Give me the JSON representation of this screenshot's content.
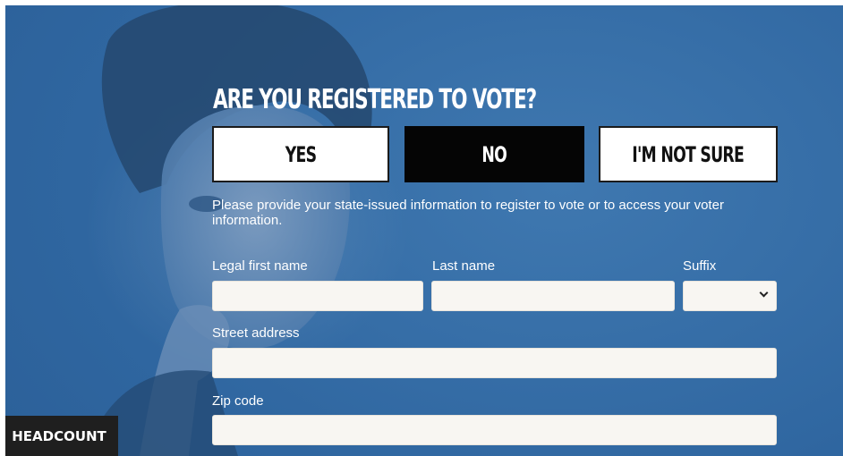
{
  "headline": "ARE YOU REGISTERED TO VOTE?",
  "choices": {
    "yes": "YES",
    "no": "NO",
    "unsure": "I'M NOT SURE"
  },
  "info_text": "Please provide your state-issued information to register to vote or to access your voter information.",
  "form": {
    "first_name_label": "Legal first name",
    "last_name_label": "Last name",
    "suffix_label": "Suffix",
    "street_label": "Street address",
    "zip_label": "Zip code"
  },
  "brand": "HEADCOUNT",
  "icons": {
    "suffix_dropdown": "chevron-down-icon"
  },
  "colors": {
    "background": "#2f66a0",
    "selected_button": "#050505",
    "button": "#ffffff",
    "brand_badge": "#1f1f1f"
  }
}
